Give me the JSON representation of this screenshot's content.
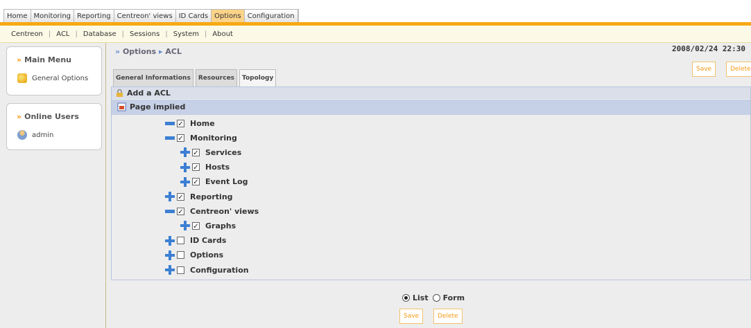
{
  "topnav": {
    "tabs": [
      {
        "label": "Home",
        "active": false
      },
      {
        "label": "Monitoring",
        "active": false
      },
      {
        "label": "Reporting",
        "active": false
      },
      {
        "label": "Centreon' views",
        "active": false
      },
      {
        "label": "ID Cards",
        "active": false
      },
      {
        "label": "Options",
        "active": true
      },
      {
        "label": "Configuration",
        "active": false
      }
    ]
  },
  "subnav": {
    "items": [
      "Centreon",
      "ACL",
      "Database",
      "Sessions",
      "System",
      "About"
    ],
    "separator": "|"
  },
  "sidebar": {
    "main_menu": {
      "title": "Main Menu",
      "arrow": "»",
      "item": "General Options"
    },
    "online_users": {
      "title": "Online Users",
      "arrow": "»",
      "item": "admin"
    }
  },
  "header": {
    "breadcrumb": {
      "prefix": "»",
      "section": "Options",
      "arrow": "▸",
      "page": "ACL"
    },
    "datetime": "2008/02/24 22:30",
    "save_label": "Save",
    "delete_label": "Delete"
  },
  "form_tabs": [
    {
      "label": "General Informations",
      "active": false
    },
    {
      "label": "Resources",
      "active": false
    },
    {
      "label": "Topology",
      "active": true
    }
  ],
  "panel": {
    "heading": "Add a ACL",
    "subheading": "Page implied"
  },
  "tree": [
    {
      "label": "Home",
      "level": 0,
      "expander": "minus",
      "checked": true
    },
    {
      "label": "Monitoring",
      "level": 0,
      "expander": "minus",
      "checked": true
    },
    {
      "label": "Services",
      "level": 1,
      "expander": "plus",
      "checked": true
    },
    {
      "label": "Hosts",
      "level": 1,
      "expander": "plus",
      "checked": true
    },
    {
      "label": "Event Log",
      "level": 1,
      "expander": "plus",
      "checked": true
    },
    {
      "label": "Reporting",
      "level": 0,
      "expander": "plus",
      "checked": true
    },
    {
      "label": "Centreon' views",
      "level": 0,
      "expander": "minus",
      "checked": true
    },
    {
      "label": "Graphs",
      "level": 1,
      "expander": "plus",
      "checked": true
    },
    {
      "label": "ID Cards",
      "level": 0,
      "expander": "plus",
      "checked": false
    },
    {
      "label": "Options",
      "level": 0,
      "expander": "plus",
      "checked": false
    },
    {
      "label": "Configuration",
      "level": 0,
      "expander": "plus",
      "checked": false
    }
  ],
  "view_mode": {
    "options": [
      {
        "label": "List",
        "selected": true
      },
      {
        "label": "Form",
        "selected": false
      }
    ]
  },
  "footer": {
    "save_label": "Save",
    "delete_label": "Delete"
  },
  "colors": {
    "accent": "#f7a815",
    "tree_icon": "#3c7fd3",
    "panel_header": "#c6d0e6"
  }
}
